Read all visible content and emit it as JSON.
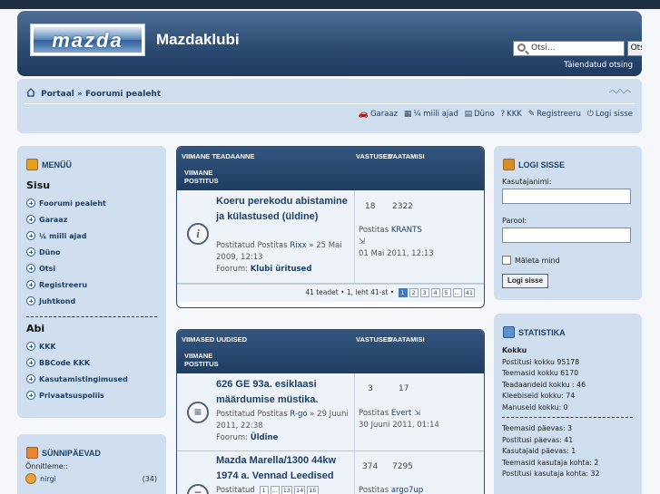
{
  "header": {
    "logo_text": "mazda",
    "site_title": "Mazdaklubi",
    "search_placeholder": "Otsi…",
    "search_button": "Otsi",
    "advanced_search": "Täiendatud otsing"
  },
  "breadcrumb": {
    "portal": "Portaal",
    "sep": "»",
    "forum_index": "Foorumi pealeht"
  },
  "quicklinks": {
    "garage": "Garaaz",
    "quarter_mile": "¼ miili ajad",
    "dyno": "Düno",
    "faq": "KKK",
    "register": "Registreeru",
    "logout": "Logi sisse"
  },
  "menu": {
    "title": "MENÜÜ",
    "section1": "Sisu",
    "items1": [
      "Foorumi pealeht",
      "Garaaz",
      "¼ miili ajad",
      "Düno",
      "Otsi",
      "Registreeru",
      "Juhtkond"
    ],
    "section2": "Abi",
    "items2": [
      "KKK",
      "BBCode KKK",
      "Kasutamistingimused",
      "Privaatsuspoliis"
    ]
  },
  "birthdays": {
    "title": "SÜNNIPÄEVAD",
    "congrats": "Õnnitleme::",
    "user": "nirgi",
    "age": "(34)"
  },
  "latest_topic": {
    "head_title": "VIIMANE TEADAANNE",
    "head_replies": "VASTUSED",
    "head_views": "VAATAMISI",
    "head_last": "VIIMANE POSTITUS",
    "topic_title": "Koeru perekodu abistamine ja külastused (üldine)",
    "posted_prefix": "Postitatud Postitas",
    "author": "Rixx",
    "posted_date": "» 25 Mai 2009, 12:13",
    "forum_label": "Foorum:",
    "forum": "Klubi üritused",
    "replies": "18",
    "views": "2322",
    "last_by_prefix": "Postitas",
    "last_by": "KRANTS",
    "last_date": "01 Mai 2011, 12:13",
    "pager_text": "41 teadet • 1, leht 41-st •",
    "pages": [
      "1",
      "2",
      "3",
      "4",
      "5",
      "...",
      "41"
    ]
  },
  "latest_news": {
    "head_title": "VIIMASED UUDISED",
    "head_replies": "VASTUSED",
    "head_views": "VAATAMISI",
    "head_last": "VIIMANE POSTITUS",
    "rows": [
      {
        "title": "626 GE 93a. esiklaasi määrdumise müstika.",
        "posted_prefix": "Postitatud Postitas",
        "author": "R-go",
        "date": "» 29 Juuni 2011, 22:38",
        "forum_label": "Foorum:",
        "forum": "Üldine",
        "replies": "3",
        "views": "17",
        "last_prefix": "Postitas",
        "last_by": "Evert",
        "last_date": "30 Juuni 2011, 01:14"
      },
      {
        "title": "Mazda Marella/1300 44kw 1974 a. Vennad Leedised",
        "posted_prefix": "Postitatud",
        "pages": [
          "1",
          "...",
          "13",
          "14",
          "15"
        ],
        "replies": "374",
        "views": "7295",
        "last_prefix": "Postitas",
        "last_by": "argo7up"
      }
    ]
  },
  "login": {
    "title": "LOGI SISSE",
    "username_label": "Kasutajanimi:",
    "password_label": "Parool:",
    "remember": "Mäleta mind",
    "submit": "Logi sisse"
  },
  "stats": {
    "title": "STATISTIKA",
    "total_head": "Kokku",
    "lines1": [
      "Postitusi kokku 95178",
      "Teemasid kokku 6170",
      "Teadaandeid kokku : 46",
      "Kleebiseid kokku: 74",
      "Manuseid kokku: 0"
    ],
    "lines2": [
      "Teemasid päevas: 3",
      "Postitusi päevas: 41",
      "Kasutajaid päevas: 1",
      "Teemasid kasutaja kohta: 2",
      "Postitusi kasutaja kohta: 32"
    ]
  },
  "colors": {
    "header_dark": "#1e3a5d",
    "panel_bg": "#cfdff0",
    "link": "#1c3f66",
    "page_active": "#3d7ac0"
  }
}
